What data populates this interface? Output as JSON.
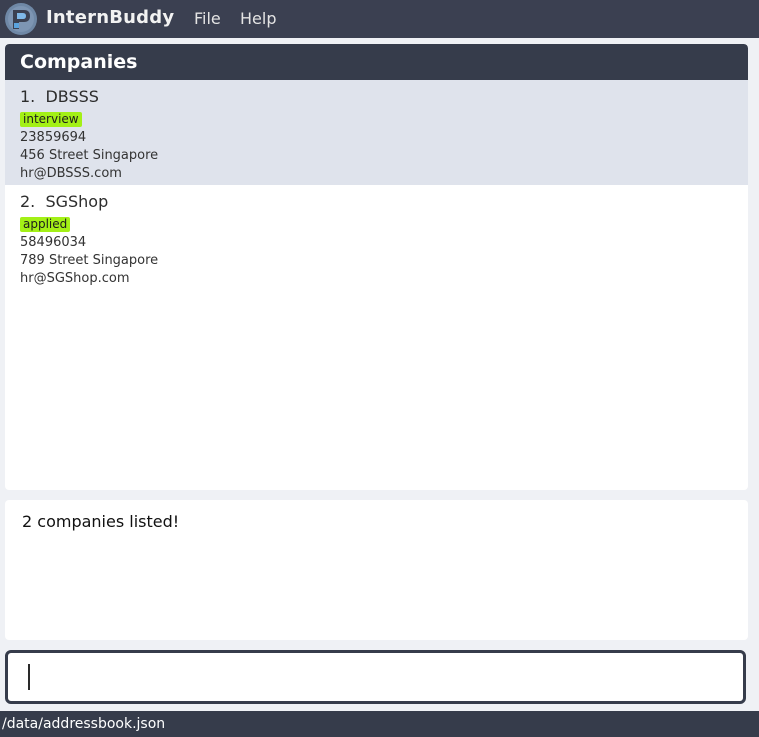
{
  "app": {
    "title": "InternBuddy",
    "logo_icon": "internbuddy-logo-icon"
  },
  "menu": {
    "items": [
      {
        "label": "File"
      },
      {
        "label": "Help"
      }
    ]
  },
  "list": {
    "header": "Companies",
    "companies": [
      {
        "index": "1.",
        "name": "DBSSS",
        "tag": "interview",
        "phone": "23859694",
        "address": "456 Street Singapore",
        "email": "hr@DBSSS.com",
        "selected": true
      },
      {
        "index": "2.",
        "name": "SGShop",
        "tag": "applied",
        "phone": "58496034",
        "address": "789 Street Singapore",
        "email": "hr@SGShop.com",
        "selected": false
      }
    ]
  },
  "result": {
    "message": "2 companies listed!"
  },
  "command": {
    "value": "",
    "placeholder": ""
  },
  "status": {
    "path": "/data/addressbook.json"
  },
  "colors": {
    "dark": "#363c4b",
    "tag": "#a3f016",
    "selected_row": "#dfe3ec",
    "background": "#eff1f5"
  }
}
